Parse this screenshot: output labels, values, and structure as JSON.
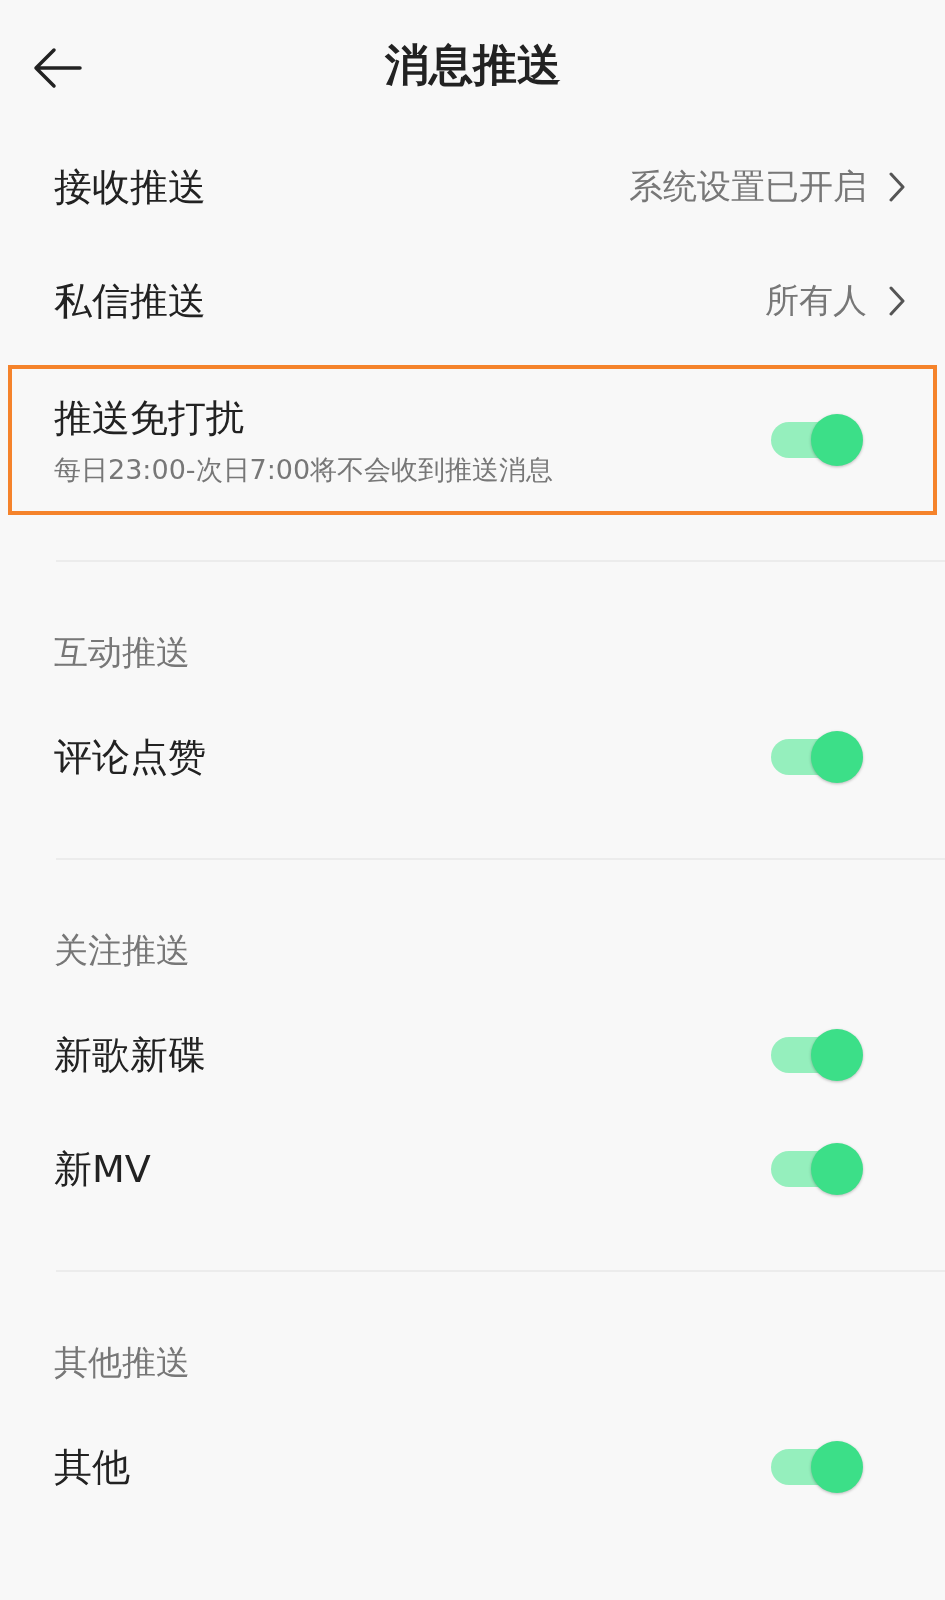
{
  "header": {
    "title": "消息推送"
  },
  "rows": [
    {
      "kind": "link",
      "label": "接收推送",
      "value": "系统设置已开启"
    },
    {
      "kind": "link",
      "label": "私信推送",
      "value": "所有人"
    },
    {
      "kind": "toggle",
      "label": "推送免打扰",
      "subtitle": "每日23:00-次日7:00将不会收到推送消息",
      "on": true,
      "highlighted": true
    }
  ],
  "sections": [
    {
      "title": "互动推送",
      "rows": [
        {
          "kind": "toggle",
          "label": "评论点赞",
          "on": true
        }
      ]
    },
    {
      "title": "关注推送",
      "rows": [
        {
          "kind": "toggle",
          "label": "新歌新碟",
          "on": true
        },
        {
          "kind": "toggle",
          "label": "新MV",
          "on": true
        }
      ]
    },
    {
      "title": "其他推送",
      "rows": [
        {
          "kind": "toggle",
          "label": "其他",
          "on": true
        }
      ]
    }
  ]
}
